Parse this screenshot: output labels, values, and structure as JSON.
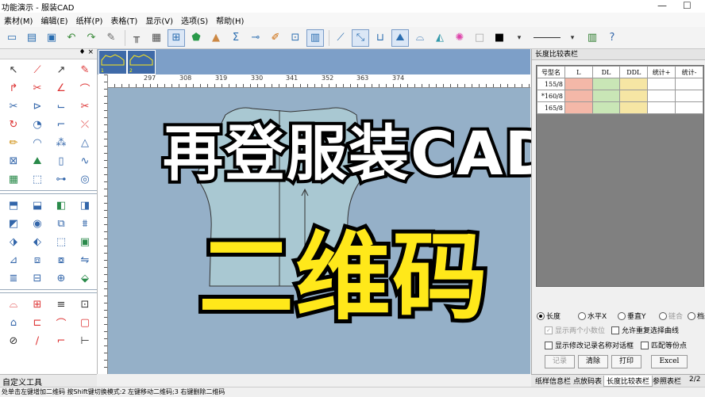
{
  "app": {
    "title": "功能演示 - 服装CAD",
    "win_min": "—",
    "win_max": "☐"
  },
  "menu": [
    "素材(M)",
    "编辑(E)",
    "纸样(P)",
    "表格(T)",
    "显示(V)",
    "选项(S)",
    "帮助(H)"
  ],
  "toolbar_icons": [
    "new-icon",
    "open-icon",
    "save-icon",
    "undo-icon",
    "redo-icon",
    "pen-icon",
    "table-icon",
    "grid-icon",
    "layout-icon",
    "shield-icon",
    "shapes-icon",
    "sigma-icon",
    "ruler-icon",
    "measure-icon",
    "mark-icon",
    "chart-icon",
    "select-icon",
    "line-icon",
    "cup-icon",
    "flower-icon",
    "mountain-icon",
    "color-wheel-icon",
    "color-box-icon",
    "line-style-icon",
    "film-icon",
    "help-icon"
  ],
  "left_panel": {
    "pin": "♦ ×",
    "footer": "自定义工具"
  },
  "pieces": [
    {
      "label": "1"
    },
    {
      "label": "2"
    }
  ],
  "ruler": {
    "marks": [
      "297",
      "308",
      "319",
      "330",
      "341",
      "352",
      "363",
      "374"
    ]
  },
  "right_panel": {
    "title": "长度比较表栏",
    "headers": [
      "号型名",
      "L",
      "DL",
      "DDL",
      "统计+",
      "统计-"
    ],
    "rows": [
      {
        "name": "155/8",
        "marker": ""
      },
      {
        "name": "160/8",
        "marker": "*"
      },
      {
        "name": "165/8",
        "marker": ""
      }
    ],
    "radio_options": [
      {
        "label": "长度",
        "selected": true
      },
      {
        "label": "水平X",
        "selected": false
      },
      {
        "label": "垂直Y",
        "selected": false
      },
      {
        "label": "链合",
        "selected": false
      },
      {
        "label": "档差",
        "selected": false
      }
    ],
    "check_options": [
      {
        "label": "显示两个小数位",
        "checked": true,
        "disabled": true
      },
      {
        "label": "允许重复选择曲线",
        "checked": false,
        "disabled": false
      },
      {
        "label": "显示修改记录名称对话框",
        "checked": false,
        "disabled": false
      },
      {
        "label": "匹配等份点",
        "checked": false,
        "disabled": false
      }
    ],
    "buttons": [
      "记录",
      "清除",
      "打印",
      "Excel"
    ],
    "tabs": [
      "纸样信息栏",
      "点放码表",
      "长度比较表栏",
      "参照表栏"
    ],
    "page": "2/2"
  },
  "status": {
    "text": "处单击左键增加二维码 按Shift键切换模式:2 左键移动二维码;3 右键删除二维码"
  },
  "overlay": {
    "line1": "再登服装CAD",
    "line2": "二维码"
  },
  "colors": {
    "canvas": "#95b0c8",
    "piece_fill": "#a9c8d2",
    "col_L": "#f4b8a8",
    "col_DL": "#c9e6b6",
    "col_DDL": "#f6e6a4",
    "overlay_yellow": "#ffe81a"
  }
}
